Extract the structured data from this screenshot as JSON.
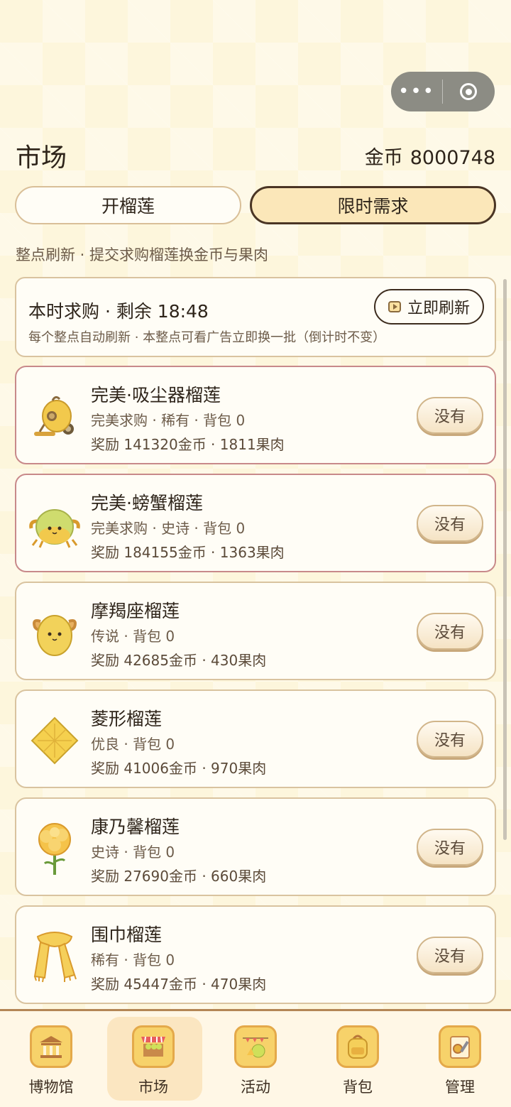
{
  "topbar": {
    "more_label": "•••"
  },
  "header": {
    "title": "市场",
    "coins_label": "金币",
    "coins_value": "8000748"
  },
  "tabs": [
    {
      "label": "开榴莲"
    },
    {
      "label": "限时需求"
    }
  ],
  "hint": "整点刷新 · 提交求购榴莲换金币与果肉",
  "timer_card": {
    "title": "本时求购 · 剩余 18:48",
    "subtitle": "每个整点自动刷新 · 本整点可看广告立即换一批（倒计时不变）",
    "refresh_label": "立即刷新"
  },
  "items": [
    {
      "name": "完美·吸尘器榴莲",
      "meta": "完美求购 · 稀有 · 背包 0",
      "reward": "奖励 141320金币 · 1811果肉",
      "button": "没有",
      "icon": "vacuum-durian-icon"
    },
    {
      "name": "完美·螃蟹榴莲",
      "meta": "完美求购 · 史诗 · 背包 0",
      "reward": "奖励 184155金币 · 1363果肉",
      "button": "没有",
      "icon": "crab-durian-icon"
    },
    {
      "name": "摩羯座榴莲",
      "meta": "传说 · 背包 0",
      "reward": "奖励 42685金币 · 430果肉",
      "button": "没有",
      "icon": "capricorn-durian-icon"
    },
    {
      "name": "菱形榴莲",
      "meta": "优良 · 背包 0",
      "reward": "奖励 41006金币 · 970果肉",
      "button": "没有",
      "icon": "diamond-durian-icon"
    },
    {
      "name": "康乃馨榴莲",
      "meta": "史诗 · 背包 0",
      "reward": "奖励 27690金币 · 660果肉",
      "button": "没有",
      "icon": "carnation-durian-icon"
    },
    {
      "name": "围巾榴莲",
      "meta": "稀有 · 背包 0",
      "reward": "奖励 45447金币 · 470果肉",
      "button": "没有",
      "icon": "scarf-durian-icon"
    }
  ],
  "nav": [
    {
      "label": "博物馆",
      "icon": "museum-icon"
    },
    {
      "label": "市场",
      "icon": "market-stall-icon"
    },
    {
      "label": "活动",
      "icon": "event-icon"
    },
    {
      "label": "背包",
      "icon": "backpack-icon"
    },
    {
      "label": "管理",
      "icon": "settings-tools-icon"
    }
  ],
  "colors": {
    "accent_tab": "#fbe7b9",
    "perfect_border": "#c8898a",
    "card_border": "#d9c39f",
    "background": "#fdf6dc"
  }
}
